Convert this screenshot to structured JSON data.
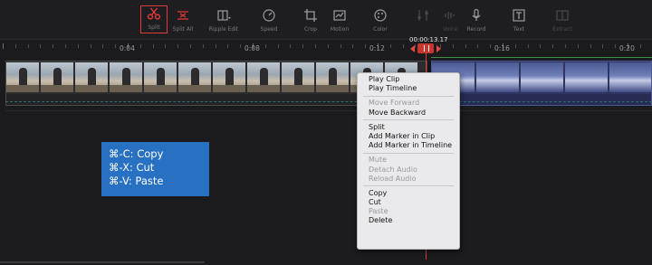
{
  "toolbar": {
    "items": [
      {
        "id": "split",
        "label": "Split",
        "icon": "scissors-icon"
      },
      {
        "id": "split_all",
        "label": "Split All",
        "icon": "split-all-icon"
      },
      {
        "id": "ripple_edit",
        "label": "Ripple Edit",
        "icon": "ripple-edit-icon"
      },
      {
        "id": "speed",
        "label": "Speed",
        "icon": "speed-icon"
      },
      {
        "id": "crop",
        "label": "Crop",
        "icon": "crop-icon"
      },
      {
        "id": "motion",
        "label": "Motion",
        "icon": "motion-icon"
      },
      {
        "id": "color",
        "label": "Color",
        "icon": "color-palette-icon"
      },
      {
        "id": "adjust",
        "label": "",
        "icon": "adjust-icon"
      },
      {
        "id": "voice",
        "label": "Voice",
        "icon": "voice-icon"
      },
      {
        "id": "record",
        "label": "Record",
        "icon": "microphone-icon"
      },
      {
        "id": "text",
        "label": "Text",
        "icon": "text-icon"
      },
      {
        "id": "extract",
        "label": "Extract",
        "icon": "extract-icon"
      }
    ]
  },
  "ruler": {
    "labels": [
      "0:04",
      "0:08",
      "0:12",
      "0:16",
      "0:20"
    ],
    "timecode": "00:00:13.17"
  },
  "shortcuts": {
    "copy": "⌘-C: Copy",
    "cut": "⌘-X: Cut",
    "paste": "⌘-V: Paste"
  },
  "context_menu": {
    "play_clip": "Play Clip",
    "play_timeline": "Play Timeline",
    "move_forward": "Move Forward",
    "move_backward": "Move Backward",
    "split": "Split",
    "add_marker_clip": "Add Marker in Clip",
    "add_marker_timeline": "Add Marker in Timeline",
    "mute": "Mute",
    "detach_audio": "Detach Audio",
    "reload_audio": "Reload Audio",
    "copy": "Copy",
    "cut": "Cut",
    "paste": "Paste",
    "delete": "Delete"
  },
  "colors": {
    "highlight": "#e23939",
    "shortcut_bg": "#2770c2",
    "playhead": "#d83b33"
  }
}
